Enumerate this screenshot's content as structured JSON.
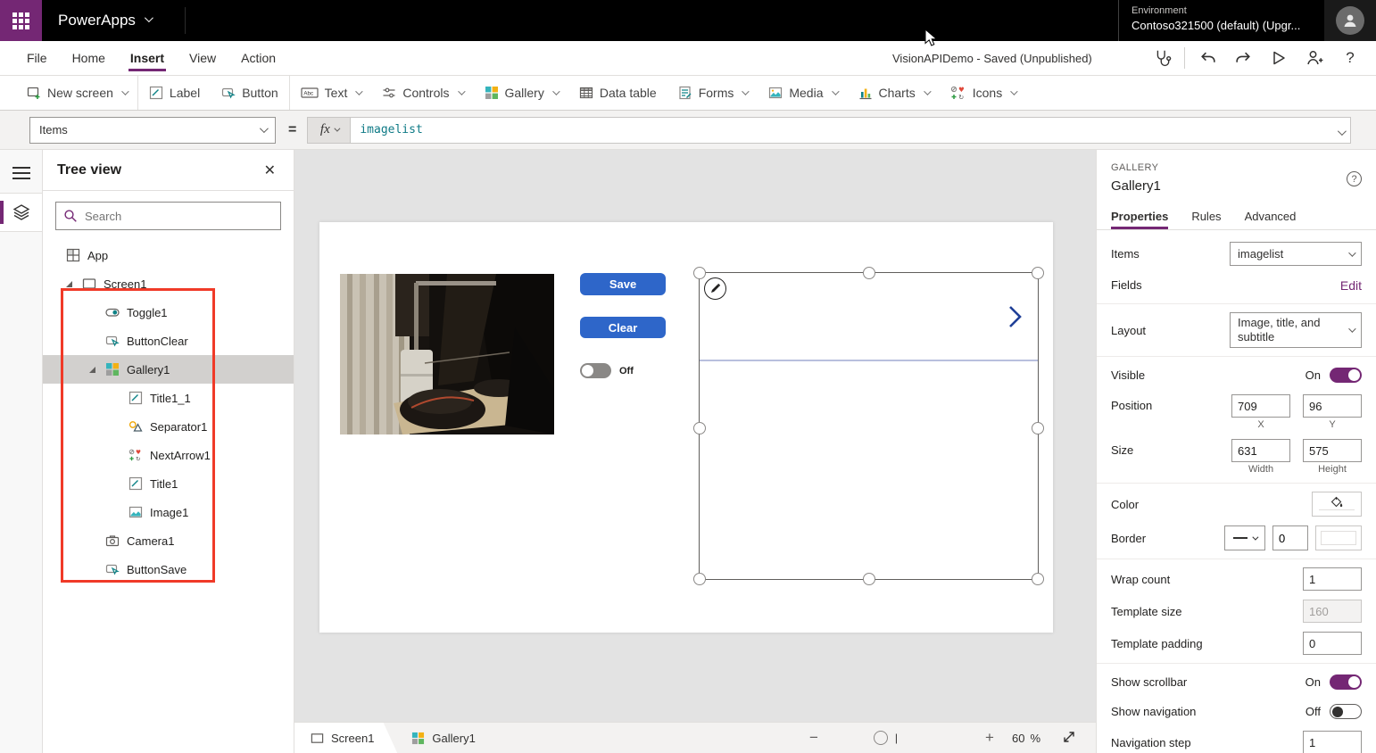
{
  "topbar": {
    "app_name": "PowerApps",
    "environment_label": "Environment",
    "environment_value": "Contoso321500 (default) (Upgr..."
  },
  "menubar": {
    "items": [
      {
        "label": "File"
      },
      {
        "label": "Home"
      },
      {
        "label": "Insert"
      },
      {
        "label": "View"
      },
      {
        "label": "Action"
      }
    ],
    "active": "Insert",
    "doc_status": "VisionAPIDemo - Saved (Unpublished)"
  },
  "ribbon": {
    "items": [
      {
        "label": "New screen"
      },
      {
        "label": "Label"
      },
      {
        "label": "Button"
      },
      {
        "label": "Text"
      },
      {
        "label": "Controls"
      },
      {
        "label": "Gallery"
      },
      {
        "label": "Data table"
      },
      {
        "label": "Forms"
      },
      {
        "label": "Media"
      },
      {
        "label": "Charts"
      },
      {
        "label": "Icons"
      }
    ]
  },
  "formula_bar": {
    "property": "Items",
    "equals": "=",
    "fx": "fx",
    "value": "imagelist"
  },
  "tree": {
    "title": "Tree view",
    "search_placeholder": "Search",
    "items": [
      {
        "label": "App"
      },
      {
        "label": "Screen1"
      },
      {
        "label": "Toggle1"
      },
      {
        "label": "ButtonClear"
      },
      {
        "label": "Gallery1"
      },
      {
        "label": "Title1_1"
      },
      {
        "label": "Separator1"
      },
      {
        "label": "NextArrow1"
      },
      {
        "label": "Title1"
      },
      {
        "label": "Image1"
      },
      {
        "label": "Camera1"
      },
      {
        "label": "ButtonSave"
      }
    ],
    "selected": "Gallery1"
  },
  "canvas": {
    "save_button": "Save",
    "clear_button": "Clear",
    "toggle_label": "Off"
  },
  "props": {
    "control_type": "GALLERY",
    "control_name": "Gallery1",
    "tabs": {
      "properties": "Properties",
      "rules": "Rules",
      "advanced": "Advanced"
    },
    "active_tab": "Properties",
    "items_label": "Items",
    "items_value": "imagelist",
    "fields_label": "Fields",
    "fields_action": "Edit",
    "layout_label": "Layout",
    "layout_value_line1": "Image, title, and",
    "layout_value_line2": "subtitle",
    "visible_label": "Visible",
    "visible_state": "On",
    "position_label": "Position",
    "pos_x": "709",
    "pos_y": "96",
    "x_caption": "X",
    "y_caption": "Y",
    "size_label": "Size",
    "size_width": "631",
    "size_height": "575",
    "width_caption": "Width",
    "height_caption": "Height",
    "color_label": "Color",
    "border_label": "Border",
    "border_width": "0",
    "wrap_label": "Wrap count",
    "wrap_value": "1",
    "template_size_label": "Template size",
    "template_size_value": "160",
    "template_padding_label": "Template padding",
    "template_padding_value": "0",
    "scrollbar_label": "Show scrollbar",
    "scrollbar_state": "On",
    "navigation_label": "Show navigation",
    "navigation_state": "Off",
    "nav_step_label": "Navigation step",
    "nav_step_value": "1"
  },
  "statusbar": {
    "crumbs": [
      {
        "label": "Screen1"
      },
      {
        "label": "Gallery1"
      }
    ],
    "zoom_value": "60",
    "zoom_unit": "%"
  },
  "icons": {
    "waffle": "3x3 white grid",
    "search": "magnifier",
    "close": "✕",
    "app_checker": "stethoscope",
    "undo": "curved-left-arrow",
    "redo": "curved-right-arrow",
    "play": "outline-triangle",
    "share": "person-plus",
    "help": "?",
    "next_arrow": "chevron-right",
    "edit_pencil": "pencil-in-circle",
    "color_fill": "paint-bucket",
    "expand": "diagonal-arrows"
  },
  "colors": {
    "brand_purple": "#742774",
    "button_blue": "#2e66c9",
    "formula_teal": "#0e7a86",
    "red_annotation": "#f03a28",
    "teal_icon": "#0f8387"
  }
}
